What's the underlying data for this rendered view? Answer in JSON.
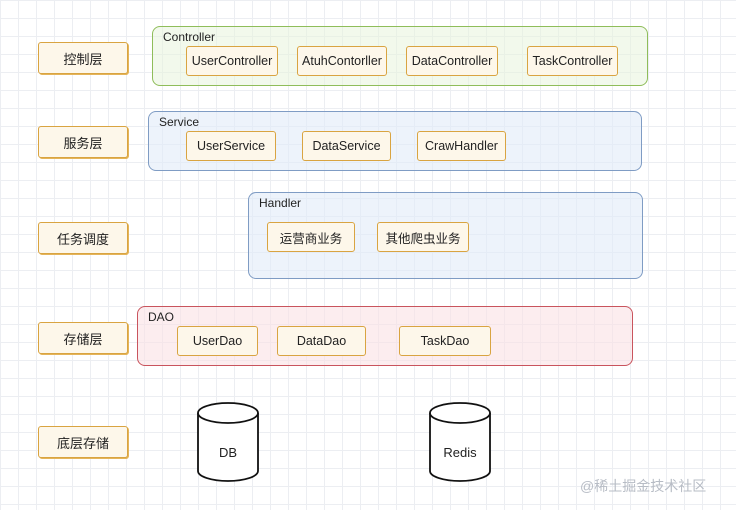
{
  "layers": [
    {
      "label": "控制层"
    },
    {
      "label": "服务层"
    },
    {
      "label": "任务调度"
    },
    {
      "label": "存储层"
    },
    {
      "label": "底层存储"
    }
  ],
  "groups": {
    "controller": {
      "title": "Controller",
      "items": [
        "UserController",
        "AtuhContorller",
        "DataController",
        "TaskController"
      ]
    },
    "service": {
      "title": "Service",
      "items": [
        "UserService",
        "DataService",
        "CrawHandler"
      ]
    },
    "handler": {
      "title": "Handler",
      "items": [
        "运营商业务",
        "其他爬虫业务"
      ]
    },
    "dao": {
      "title": "DAO",
      "items": [
        "UserDao",
        "DataDao",
        "TaskDao"
      ]
    }
  },
  "storage": [
    "DB",
    "Redis"
  ],
  "watermark": "@稀土掘金技术社区",
  "colors": {
    "node_border": "#d9a441",
    "controller_border": "#8fbd5a",
    "service_border": "#7f9cc4",
    "dao_border": "#c9545d"
  }
}
